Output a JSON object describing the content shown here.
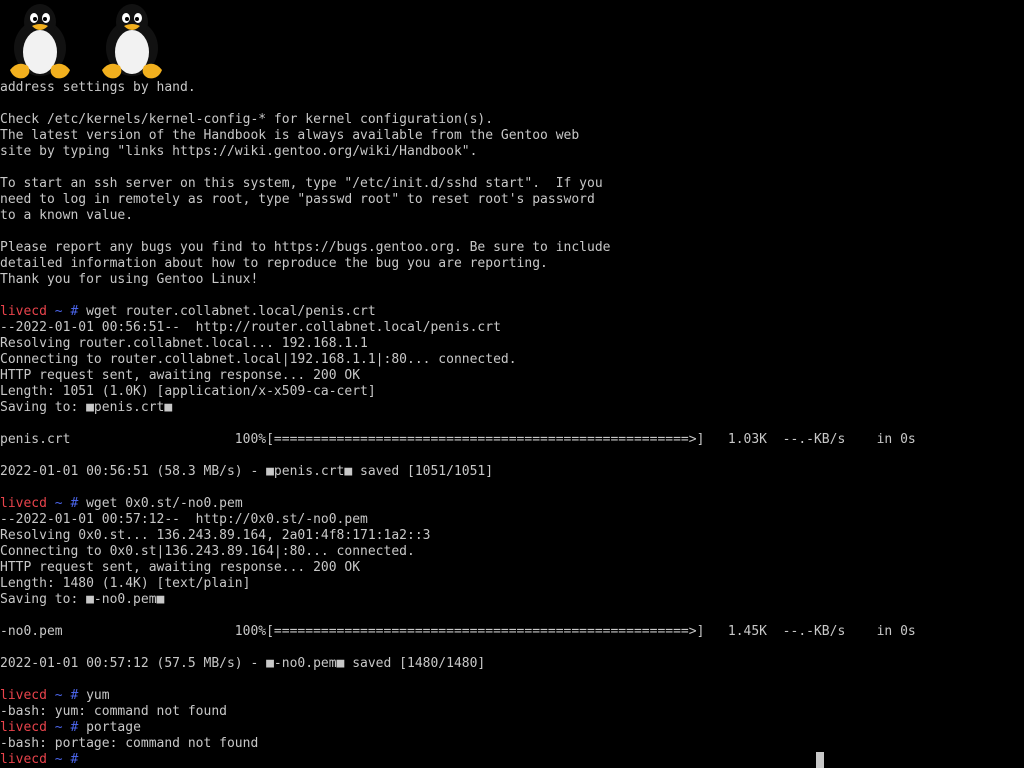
{
  "colors": {
    "background": "#000000",
    "text": "#c8c8c8",
    "prompt_host": "#e8434b",
    "prompt_path": "#4a64e8"
  },
  "logos": [
    {
      "icon": "tux-penguin-icon"
    },
    {
      "icon": "tux-penguin-icon"
    }
  ],
  "lines": [
    {
      "text": "address settings by hand."
    },
    {
      "text": ""
    },
    {
      "text": "Check /etc/kernels/kernel-config-* for kernel configuration(s)."
    },
    {
      "text": "The latest version of the Handbook is always available from the Gentoo web"
    },
    {
      "text": "site by typing \"links https://wiki.gentoo.org/wiki/Handbook\"."
    },
    {
      "text": ""
    },
    {
      "text": "To start an ssh server on this system, type \"/etc/init.d/sshd start\".  If you"
    },
    {
      "text": "need to log in remotely as root, type \"passwd root\" to reset root's password"
    },
    {
      "text": "to a known value."
    },
    {
      "text": ""
    },
    {
      "text": "Please report any bugs you find to https://bugs.gentoo.org. Be sure to include"
    },
    {
      "text": "detailed information about how to reproduce the bug you are reporting."
    },
    {
      "text": "Thank you for using Gentoo Linux!"
    },
    {
      "text": ""
    },
    {
      "prompt": {
        "host": "livecd",
        "path": "~",
        "symbol": "#"
      },
      "text": " wget router.collabnet.local/penis.crt"
    },
    {
      "text": "--2022-01-01 00:56:51--  http://router.collabnet.local/penis.crt"
    },
    {
      "text": "Resolving router.collabnet.local... 192.168.1.1"
    },
    {
      "text": "Connecting to router.collabnet.local|192.168.1.1|:80... connected."
    },
    {
      "text": "HTTP request sent, awaiting response... 200 OK"
    },
    {
      "text": "Length: 1051 (1.0K) [application/x-x509-ca-cert]"
    },
    {
      "text": "Saving to: ■penis.crt■"
    },
    {
      "text": ""
    },
    {
      "text": "penis.crt                     100%[=====================================================>]   1.03K  --.-KB/s    in 0s"
    },
    {
      "text": ""
    },
    {
      "text": "2022-01-01 00:56:51 (58.3 MB/s) - ■penis.crt■ saved [1051/1051]"
    },
    {
      "text": ""
    },
    {
      "prompt": {
        "host": "livecd",
        "path": "~",
        "symbol": "#"
      },
      "text": " wget 0x0.st/-no0.pem"
    },
    {
      "text": "--2022-01-01 00:57:12--  http://0x0.st/-no0.pem"
    },
    {
      "text": "Resolving 0x0.st... 136.243.89.164, 2a01:4f8:171:1a2::3"
    },
    {
      "text": "Connecting to 0x0.st|136.243.89.164|:80... connected."
    },
    {
      "text": "HTTP request sent, awaiting response... 200 OK"
    },
    {
      "text": "Length: 1480 (1.4K) [text/plain]"
    },
    {
      "text": "Saving to: ■-no0.pem■"
    },
    {
      "text": ""
    },
    {
      "text": "-no0.pem                      100%[=====================================================>]   1.45K  --.-KB/s    in 0s"
    },
    {
      "text": ""
    },
    {
      "text": "2022-01-01 00:57:12 (57.5 MB/s) - ■-no0.pem■ saved [1480/1480]"
    },
    {
      "text": ""
    },
    {
      "prompt": {
        "host": "livecd",
        "path": "~",
        "symbol": "#"
      },
      "text": " yum"
    },
    {
      "text": "-bash: yum: command not found"
    },
    {
      "prompt": {
        "host": "livecd",
        "path": "~",
        "symbol": "#"
      },
      "text": " portage"
    },
    {
      "text": "-bash: portage: command not found"
    },
    {
      "prompt": {
        "host": "livecd",
        "path": "~",
        "symbol": "#"
      },
      "text": ""
    }
  ]
}
